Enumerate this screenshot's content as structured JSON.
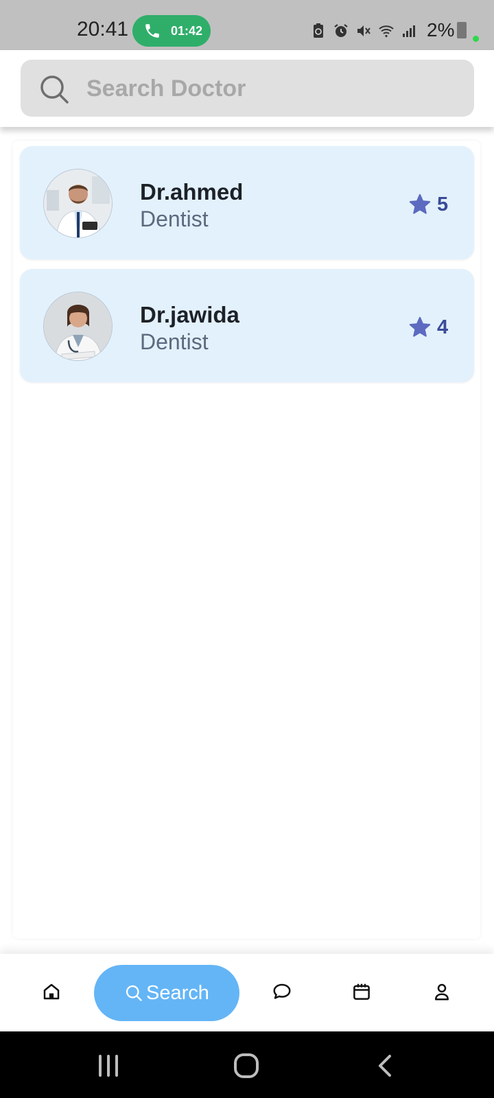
{
  "status_bar": {
    "time": "20:41",
    "call_duration": "01:42",
    "battery": "2%",
    "icons": [
      "battery-saver-icon",
      "alarm-icon",
      "mute-icon",
      "wifi-icon",
      "signal-icon"
    ]
  },
  "search": {
    "placeholder": "Search Doctor",
    "value": ""
  },
  "doctors": [
    {
      "name": "Dr.ahmed",
      "specialty": "Dentist",
      "rating": "5"
    },
    {
      "name": "Dr.jawida",
      "specialty": "Dentist",
      "rating": "4"
    }
  ],
  "bottom_nav": {
    "items": [
      "home-icon",
      "search-icon",
      "chat-icon",
      "calendar-icon",
      "profile-icon"
    ],
    "active_label": "Search"
  },
  "colors": {
    "status_bar": "#c0c0c0",
    "call_pill": "#2fae6a",
    "card_bg": "#e3f1fc",
    "star": "#5c6bc0",
    "nav_active": "#64b5f6"
  }
}
